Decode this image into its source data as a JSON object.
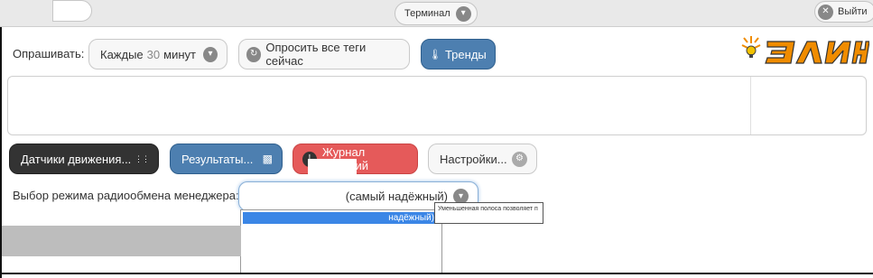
{
  "topbar": {
    "terminal_label": "Терминал",
    "logout_label": "Выйти"
  },
  "poll": {
    "label": "Опрашивать:",
    "interval_prefix": "Каждые",
    "interval_value": "30",
    "interval_unit": "минут",
    "poll_all_label": "Опросить все теги сейчас",
    "trends_label": "Тренды"
  },
  "logo": {
    "text": "ЭлИн"
  },
  "actions": {
    "motion_label": "Датчики движения...",
    "results_label": "Результаты...",
    "journal_label": "Журнал событий",
    "settings_label": "Настройки..."
  },
  "radio": {
    "label": "Выбор режима радиообмена менеджера:",
    "selected_value": "(самый надёжный)",
    "dropdown_highlighted": "надёжный)",
    "tooltip_text": "Уменьшенная полоса позволяет п"
  },
  "colors": {
    "accent_blue": "#4d7fb0",
    "danger_red": "#e55a5a",
    "dark": "#333333",
    "logo_orange": "#f08c00"
  }
}
